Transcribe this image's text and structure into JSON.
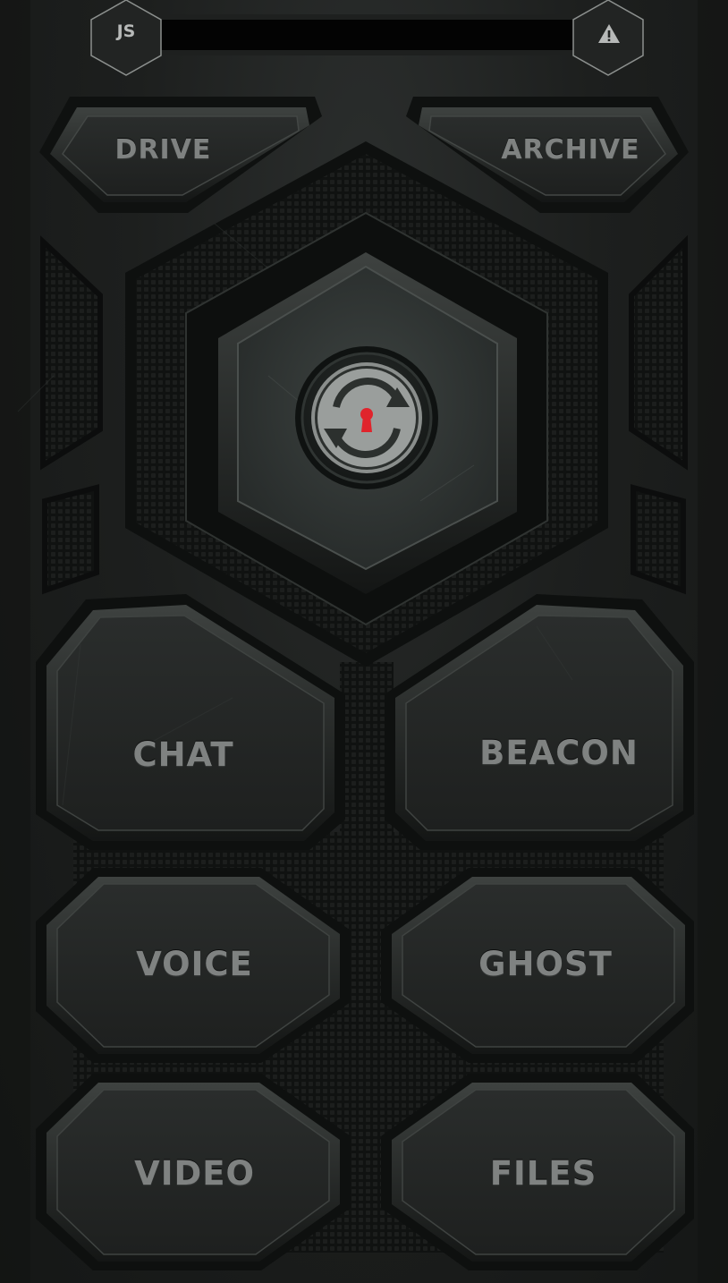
{
  "header": {
    "profile_initials": "JS",
    "status_bar_text": "",
    "alert_icon": "warning-triangle-icon"
  },
  "top_buttons": {
    "drive_label": "DRIVE",
    "archive_label": "ARCHIVE"
  },
  "center": {
    "icon": "sync-lock-icon",
    "keyhole_color": "#e0242c"
  },
  "grid_buttons": {
    "chat_label": "CHAT",
    "beacon_label": "BEACON",
    "voice_label": "VOICE",
    "ghost_label": "GHOST",
    "video_label": "VIDEO",
    "files_label": "FILES"
  },
  "colors": {
    "background": "#1d1f1e",
    "button_face": "#232524",
    "label_text": "#7f8281",
    "accent": "#e0242c"
  }
}
